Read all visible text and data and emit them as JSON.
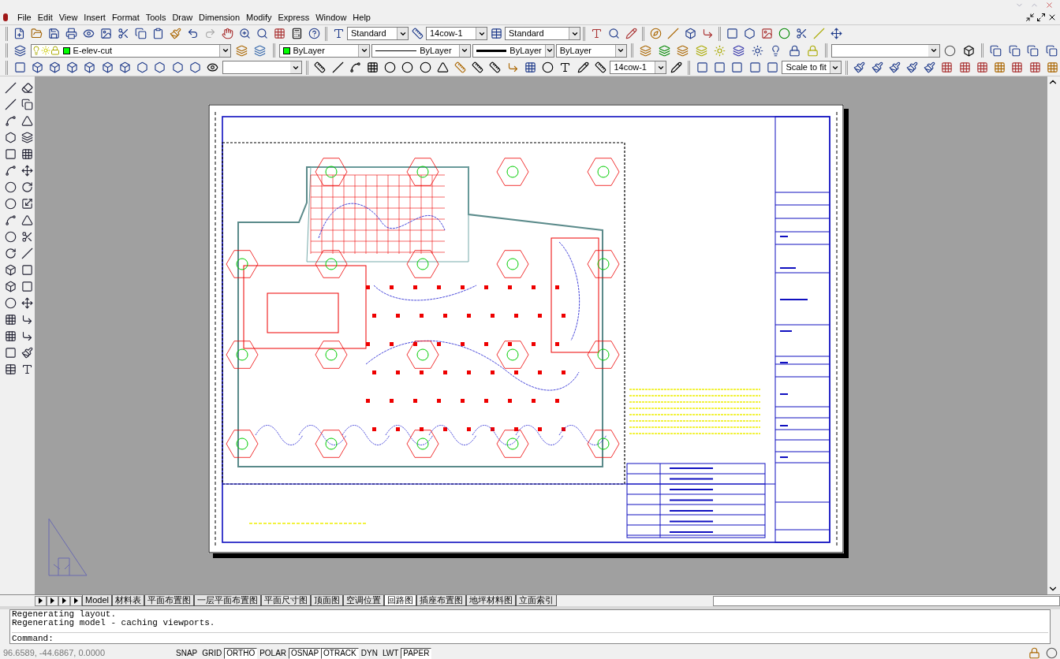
{
  "menu": [
    "File",
    "Edit",
    "View",
    "Insert",
    "Format",
    "Tools",
    "Draw",
    "Dimension",
    "Modify",
    "Express",
    "Window",
    "Help"
  ],
  "styles_toolbar": {
    "text_style": "Standard",
    "dim_style": "14cow-1",
    "table_style": "Standard"
  },
  "layers_toolbar": {
    "layer": "E-elev-cut"
  },
  "properties_toolbar": {
    "color_control": "ByLayer",
    "linetype": "ByLayer",
    "lineweight": "ByLayer",
    "plot_style": "ByLayer"
  },
  "dimension_toolbar": {
    "dim_style": "14cow-1"
  },
  "viewports_toolbar": {
    "scale": "Scale to fit"
  },
  "layout_tabs": [
    {
      "label": "Model",
      "selected": false
    },
    {
      "label": "材料表",
      "selected": false
    },
    {
      "label": "平面布置图",
      "selected": false
    },
    {
      "label": "一层平面布置图",
      "selected": false
    },
    {
      "label": "平面尺寸图",
      "selected": false
    },
    {
      "label": "顶面图",
      "selected": false
    },
    {
      "label": "空调位置",
      "selected": false
    },
    {
      "label": "回路图",
      "selected": true
    },
    {
      "label": "插座布置图",
      "selected": false
    },
    {
      "label": "地坪材料图",
      "selected": false
    },
    {
      "label": "立面索引",
      "selected": false
    }
  ],
  "command_history": [
    "Regenerating layout.",
    "Regenerating model - caching viewports."
  ],
  "command_prompt": "Command:",
  "status_bar": {
    "coordinates": "96.6589, -44.6867, 0.0000",
    "toggles": [
      {
        "label": "SNAP",
        "on": false
      },
      {
        "label": "GRID",
        "on": false
      },
      {
        "label": "ORTHO",
        "on": true
      },
      {
        "label": "POLAR",
        "on": false
      },
      {
        "label": "OSNAP",
        "on": true
      },
      {
        "label": "OTRACK",
        "on": true
      },
      {
        "label": "DYN",
        "on": false
      },
      {
        "label": "LWT",
        "on": false
      },
      {
        "label": "PAPER",
        "on": true
      }
    ]
  }
}
